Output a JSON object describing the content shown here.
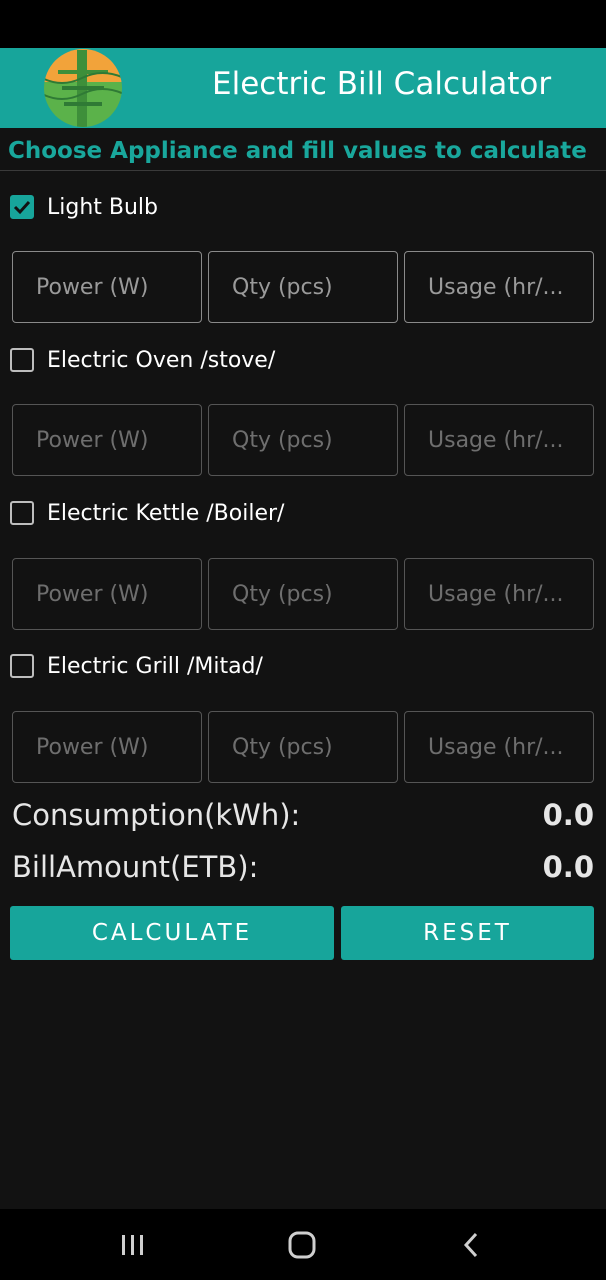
{
  "app": {
    "title": "Electric Bill Calculator",
    "subtitle": "Choose Appliance and fill values to calculate"
  },
  "fields": {
    "power_placeholder": "Power (W)",
    "qty_placeholder": "Qty (pcs)",
    "usage_placeholder": "Usage (hr/..."
  },
  "appliances": [
    {
      "label": "Light Bulb",
      "checked": true
    },
    {
      "label": "Electric Oven /stove/",
      "checked": false
    },
    {
      "label": "Electric Kettle /Boiler/",
      "checked": false
    },
    {
      "label": "Electric Grill /Mitad/",
      "checked": false
    }
  ],
  "results": {
    "consumption_label": "Consumption(kWh):",
    "consumption_value": "0.0",
    "bill_label": "BillAmount(ETB):",
    "bill_value": "0.0"
  },
  "buttons": {
    "calculate": "CALCULATE",
    "reset": "RESET"
  },
  "colors": {
    "accent": "#17a59b",
    "background": "#121212"
  },
  "icons": {
    "logo": "electric-pole-sun-logo",
    "checkbox_check": "check-icon",
    "nav_recents": "recents-icon",
    "nav_home": "home-icon",
    "nav_back": "back-icon"
  }
}
